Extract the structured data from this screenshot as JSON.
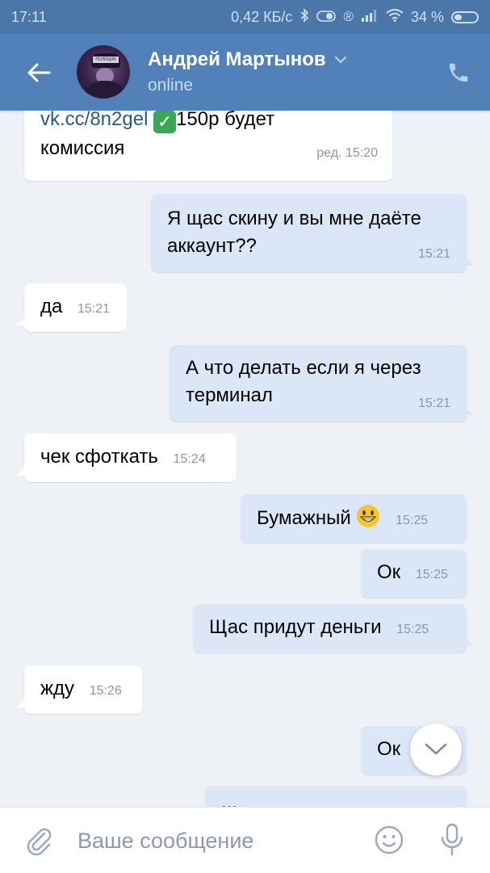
{
  "status_bar": {
    "time": "17:11",
    "network_speed": "0,42 КБ/с",
    "bluetooth_icon": "bluetooth-icon",
    "glyph_r": "®",
    "battery_percent": "34 %"
  },
  "header": {
    "contact_name": "Андрей Мартынов",
    "contact_status": "online",
    "avatar_badge": "ПОЛИЦИЯ"
  },
  "messages": [
    {
      "dir": "in",
      "link": "vk.cc/8n2gel",
      "text_after_emoji": "150р будет",
      "text_line2": "комиссия",
      "time": "ред. 15:20"
    },
    {
      "dir": "out",
      "line1": "Я щас скину и вы мне даёте",
      "line2": "аккаунт??",
      "time": "15:21"
    },
    {
      "dir": "in",
      "text": "да",
      "time": "15:21"
    },
    {
      "dir": "out",
      "line1": "А что делать если я через",
      "line2": "терминал",
      "time": "15:21"
    },
    {
      "dir": "in",
      "text": "чек сфоткать",
      "time": "15:24"
    },
    {
      "dir": "out",
      "text": "Бумажный",
      "time": "15:25"
    },
    {
      "dir": "out",
      "text": "Ок",
      "time": "15:25"
    },
    {
      "dir": "out",
      "text": "Щас придут деньги",
      "time": "15:25"
    },
    {
      "dir": "in",
      "text": "жду",
      "time": "15:26"
    },
    {
      "dir": "out",
      "text": "Ок",
      "time": ""
    },
    {
      "dir": "out",
      "text": "..."
    }
  ],
  "composer": {
    "placeholder": "Ваше сообщение"
  },
  "colors": {
    "header": "#5181b8",
    "status_bar": "#4a76a8",
    "incoming_bubble": "#ffffff",
    "outgoing_bubble": "#dbe7f7",
    "background": "#eef1f5"
  }
}
